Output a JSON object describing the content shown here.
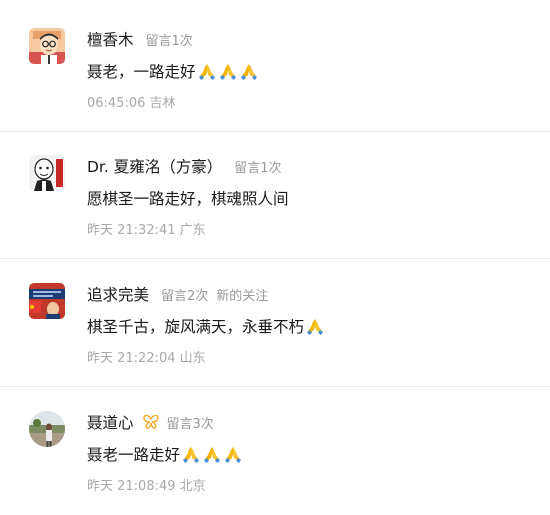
{
  "comments": [
    {
      "author": "檀香木",
      "badges": [
        "留言1次"
      ],
      "text": "聂老，一路走好",
      "pray_count": 3,
      "time": "06:45:06",
      "location": "吉林",
      "avatar": "cartoon-man-avatar"
    },
    {
      "author": "Dr. 夏雍洺（方豪）",
      "badges": [
        "留言1次"
      ],
      "text": "愿棋圣一路走好，棋魂照人间",
      "pray_count": 0,
      "time": "昨天 21:32:41",
      "location": "广东",
      "avatar": "portrait-sketch-avatar"
    },
    {
      "author": "追求完美",
      "badges": [
        "留言2次",
        "新的关注"
      ],
      "text": "棋圣千古，旋风满天，永垂不朽",
      "pray_count": 1,
      "time": "昨天 21:22:04",
      "location": "山东",
      "avatar": "flag-banner-avatar"
    },
    {
      "author": "聂道心",
      "badges": [
        "留言3次"
      ],
      "text": "聂老一路走好",
      "pray_count": 3,
      "time": "昨天 21:08:49",
      "location": "北京",
      "avatar": "outdoor-photo-avatar",
      "has_butterfly": true
    }
  ],
  "colors": {
    "text_primary": "#1a1a1a",
    "text_secondary": "#9a9a9a",
    "divider": "#e9e9e9",
    "butterfly": "#f5a623"
  }
}
